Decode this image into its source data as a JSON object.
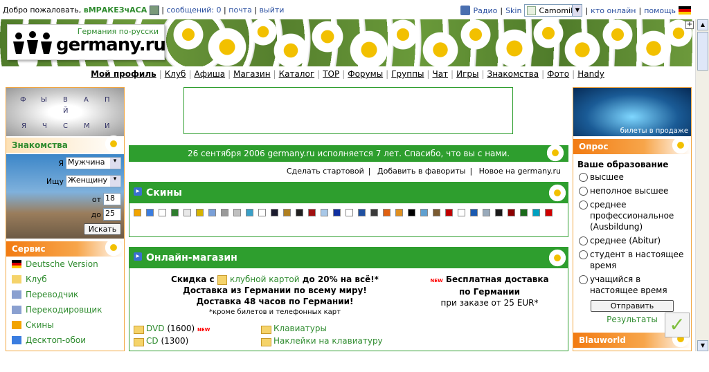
{
  "topbar": {
    "welcome": "Добро пожаловать,",
    "user": "вМРАКЕЗчАСА",
    "messages": "сообщений: 0",
    "mail": "почта",
    "logout": "выйти",
    "radio": "Радио",
    "skin": "Skin",
    "skin_value": "Camomile",
    "who_online": "кто онлайн",
    "help": "помощь"
  },
  "logo": {
    "subtitle": "Германия по-русски",
    "name": "germany.ru"
  },
  "nav": [
    "Мой профиль",
    "Клуб",
    "Афиша",
    "Магазин",
    "Каталог",
    "TOP",
    "Форумы",
    "Группы",
    "Чат",
    "Игры",
    "Знакомства",
    "Фото",
    "Handy"
  ],
  "keyboard": [
    "Ф",
    "Ы",
    "В",
    "А",
    "П",
    "Й",
    "Я",
    "Ч",
    "С",
    "М",
    "И"
  ],
  "dating": {
    "title": "Знакомства",
    "i_label": "Я",
    "i_value": "Мужчина",
    "seek_label": "Ищу",
    "seek_value": "Женщину",
    "from_label": "от",
    "from_value": "18",
    "to_label": "до",
    "to_value": "25",
    "search": "Искать"
  },
  "service": {
    "title": "Сервис",
    "items": [
      "Deutsche Version",
      "Клуб",
      "Переводчик",
      "Перекодировщик",
      "Скины",
      "Десктоп-обои"
    ]
  },
  "announcement": "26 сентября 2006 germany.ru исполняется 7 лет. Спасибо, что вы с нами.",
  "links": [
    "Сделать стартовой",
    "Добавить в фавориты",
    "Новое на germany.ru"
  ],
  "skins": {
    "title": "Скины",
    "colors": [
      "#f2a400",
      "#3a7de0",
      "#ffffff",
      "#2e7d2e",
      "#e8e8e8",
      "#d6b300",
      "#7aa0d8",
      "#9a9a9a",
      "#c0c0c0",
      "#3aa0c8",
      "#ffffff",
      "#1a1a2e",
      "#b08020",
      "#202020",
      "#a01010",
      "#a8c8e8",
      "#1030a0",
      "#ffffff",
      "#2050a0",
      "#3a3a3a",
      "#e06010",
      "#e09020",
      "#000000",
      "#60a0d0",
      "#7a5a30",
      "#c00000",
      "#ffffff",
      "#1a5ab0",
      "#9ab",
      "#1a1a1a",
      "#8b0000",
      "#1a6a1a",
      "#00a0c0",
      "#d00000"
    ]
  },
  "shop": {
    "title": "Онлайн-магазин",
    "promo_pre": "Скидка с",
    "promo_link": "клубной картой",
    "promo_post": "до 20% на всё!*",
    "line2": "Доставка из Германии по всему миру!",
    "line3": "Доставка 48 часов по Германии!",
    "footnote": "*кроме билетов и телефонных карт",
    "free_title": "Бесплатная доставка",
    "free_line2": "по Германии",
    "free_line3": "при заказе от 25 EUR*",
    "cats": [
      {
        "name": "DVD",
        "count": "(1600)"
      },
      {
        "name": "CD",
        "count": "(1300)"
      },
      {
        "name": "Клавиатуры",
        "count": ""
      },
      {
        "name": "Наклейки на клавиатуру",
        "count": ""
      }
    ]
  },
  "poll": {
    "title": "Опрос",
    "question": "Ваше образование",
    "options": [
      "высшее",
      "неполное высшее",
      "среднее профессиональное (Ausbildung)",
      "среднее (Abitur)",
      "студент в настоящее время",
      "учащийся в настоящее время"
    ],
    "submit": "Отправить",
    "results": "Результаты"
  },
  "ballet": "билеты в продаже",
  "blauworld": "Blauworld"
}
